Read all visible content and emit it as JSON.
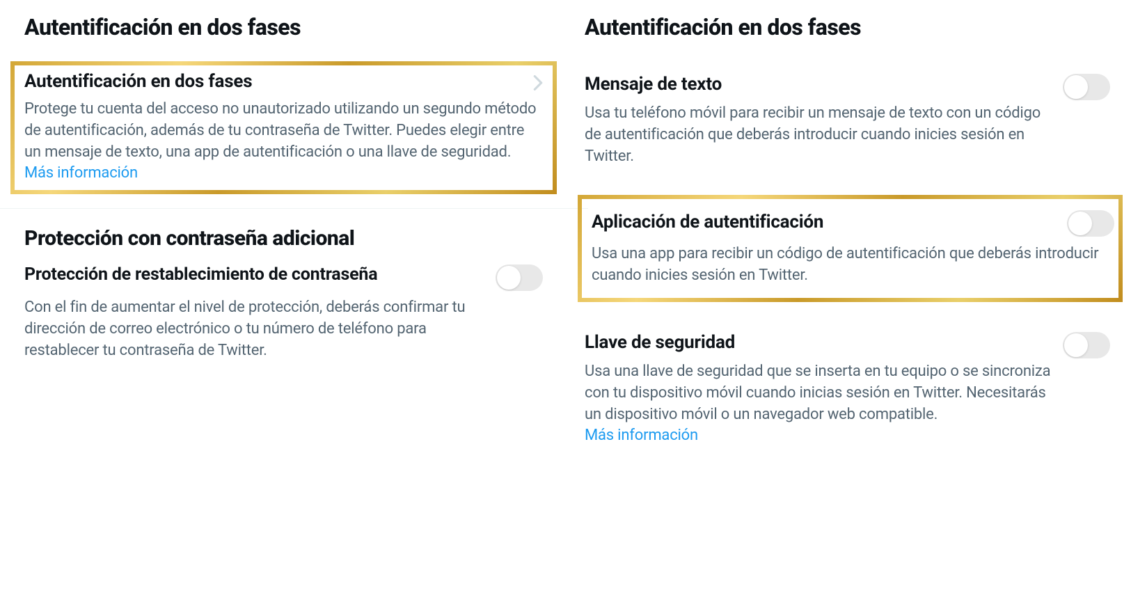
{
  "left": {
    "section1_title": "Autentificación en dos fases",
    "two_factor": {
      "title": "Autentificación en dos fases",
      "desc_1": "Protege tu cuenta del acceso no unautorizado utilizando un segundo método de autentificación, además de tu contraseña de Twitter. Puedes elegir entre un mensaje de texto, una app de autentificación o una llave de seguridad. ",
      "learn_more": "Más información"
    },
    "section2_title": "Protección con contraseña adicional",
    "password_reset": {
      "title": "Protección de restablecimiento de contraseña",
      "desc": "Con el fin de aumentar el nivel de protección, deberás confirmar tu dirección de correo electrónico o tu número de teléfono para restablecer tu contraseña de Twitter."
    }
  },
  "right": {
    "section_title": "Autentificación en dos fases",
    "text_message": {
      "title": "Mensaje de texto",
      "desc": "Usa tu teléfono móvil para recibir un mensaje de texto con un código de autentificación que deberás introducir cuando inicies sesión en Twitter."
    },
    "auth_app": {
      "title": "Aplicación de autentificación",
      "desc": "Usa una app para recibir un código de autentificación que deberás introducir cuando inicies sesión en Twitter."
    },
    "security_key": {
      "title": "Llave de seguridad",
      "desc_1": "Usa una llave de seguridad que se inserta en tu equipo o se sincroniza con tu dispositivo móvil cuando inicias sesión en Twitter. Necesitarás un dispositivo móvil o un navegador web compatible. ",
      "learn_more": "Más información"
    }
  }
}
